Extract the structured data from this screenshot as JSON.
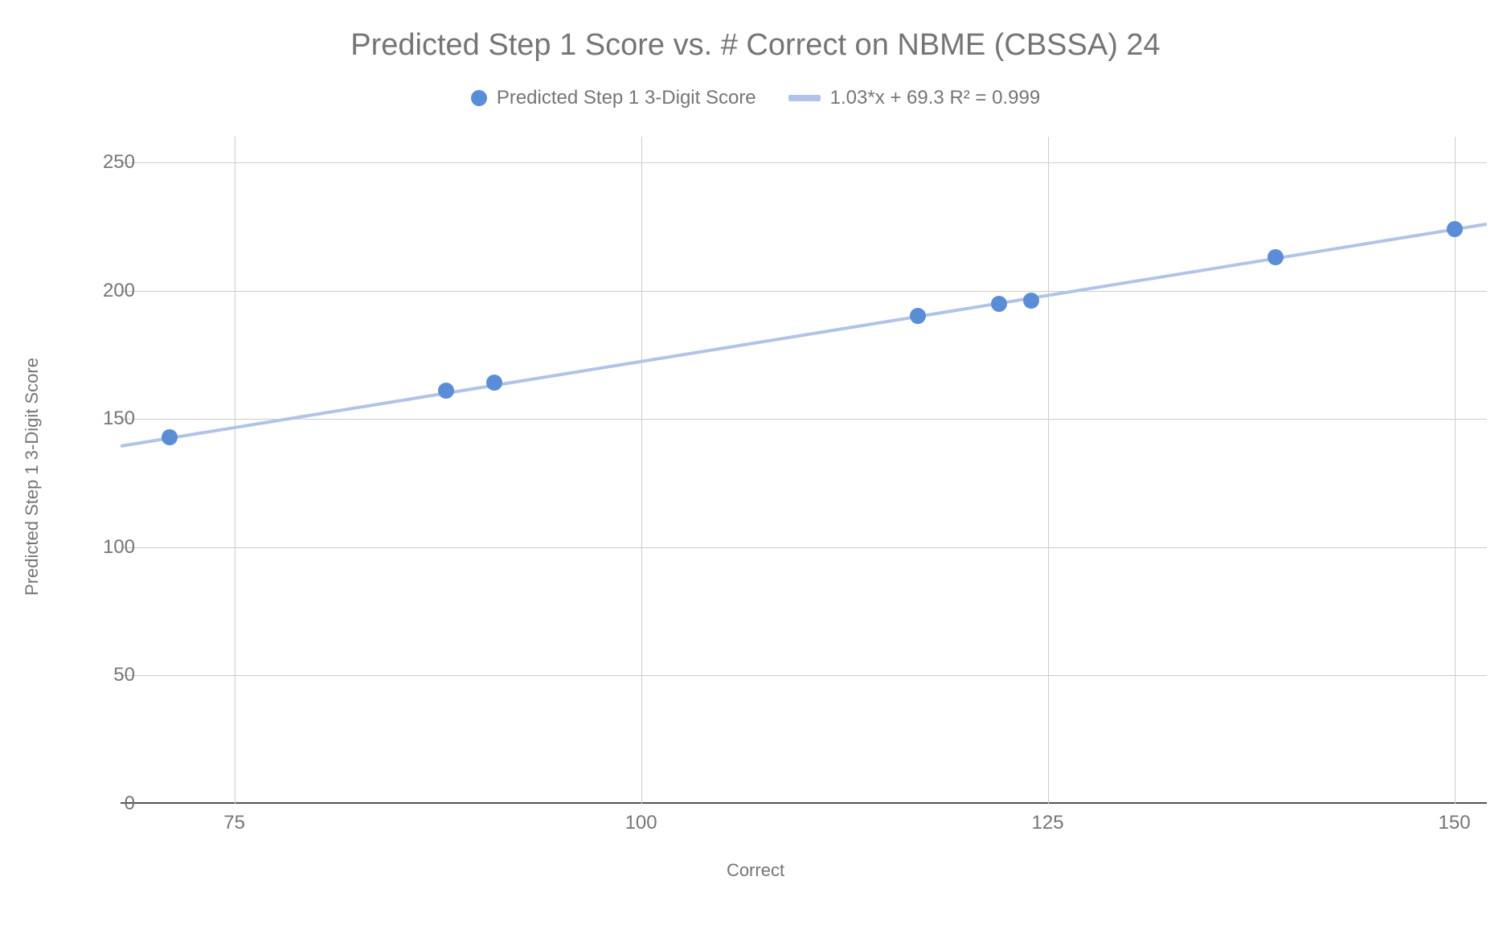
{
  "chart_data": {
    "type": "scatter",
    "title": "Predicted Step 1 Score vs. # Correct on NBME (CBSSA) 24",
    "xlabel": "Correct",
    "ylabel": "Predicted Step 1 3-Digit Score",
    "legend": {
      "series_label": "Predicted Step 1 3-Digit Score",
      "trendline_label": "1.03*x + 69.3 R² = 0.999"
    },
    "x": [
      71,
      88,
      91,
      117,
      122,
      124,
      139,
      150
    ],
    "y": [
      143,
      161,
      164,
      190,
      195,
      196,
      213,
      224
    ],
    "trendline": {
      "slope": 1.03,
      "intercept": 69.3,
      "r_squared": 0.999
    },
    "xlim": [
      68,
      152
    ],
    "ylim": [
      0,
      260
    ],
    "x_ticks": [
      75,
      100,
      125,
      150
    ],
    "y_ticks": [
      0,
      50,
      100,
      150,
      200,
      250
    ]
  }
}
